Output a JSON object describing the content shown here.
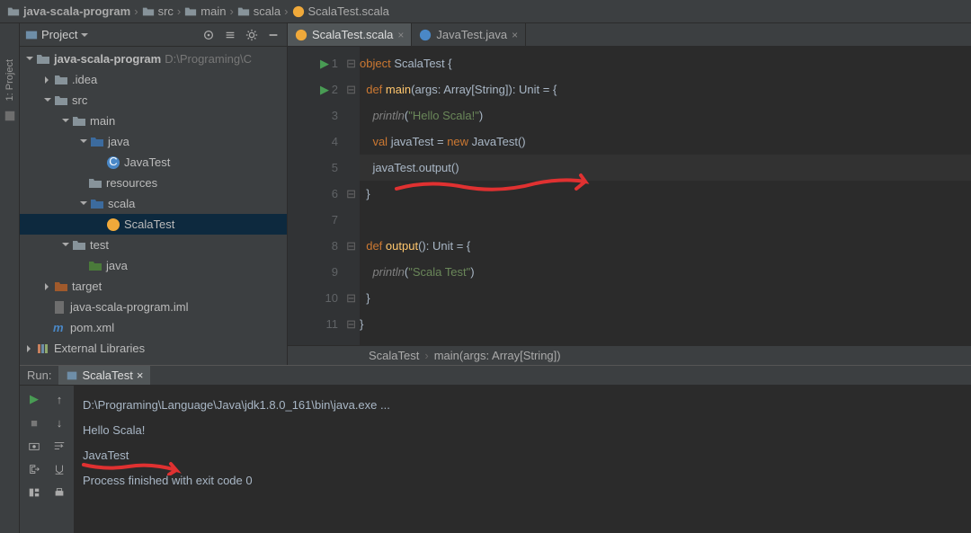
{
  "breadcrumb": {
    "project": "java-scala-program",
    "items": [
      "src",
      "main",
      "scala"
    ],
    "file": "ScalaTest.scala"
  },
  "sidebar": {
    "project_label": "1: Project"
  },
  "tool": {
    "title": "Project"
  },
  "tree": {
    "root": {
      "name": "java-scala-program",
      "hint": "D:\\Programing\\C"
    },
    "idea": ".idea",
    "src": "src",
    "main": "main",
    "java": "java",
    "javaTest": "JavaTest",
    "resources": "resources",
    "scala": "scala",
    "scalaTest": "ScalaTest",
    "test": "test",
    "testjava": "java",
    "target": "target",
    "iml": "java-scala-program.iml",
    "pom": "pom.xml",
    "ext": "External Libraries"
  },
  "tabs": [
    {
      "label": "ScalaTest.scala",
      "icon": "scala",
      "active": true
    },
    {
      "label": "JavaTest.java",
      "icon": "java",
      "active": false
    }
  ],
  "code": {
    "l1": {
      "a": "object ",
      "b": "ScalaTest ",
      "c": "{"
    },
    "l2": {
      "a": "  def ",
      "b": "main",
      "c": "(args: Array[",
      "d": "String",
      "e": "]): Unit = {"
    },
    "l3": {
      "a": "    ",
      "b": "println",
      "c": "(",
      "d": "\"Hello Scala!\"",
      "e": ")"
    },
    "l4": {
      "a": "    val ",
      "b": "javaTest = ",
      "c": "new ",
      "d": "JavaTest()"
    },
    "l5": {
      "a": "    javaTest.output()"
    },
    "l6": {
      "a": "  }"
    },
    "l7": {
      "a": ""
    },
    "l8": {
      "a": "  def ",
      "b": "output",
      "c": "(): Unit = {"
    },
    "l9": {
      "a": "    ",
      "b": "println",
      "c": "(",
      "d": "\"Scala Test\"",
      "e": ")"
    },
    "l10": {
      "a": "  }"
    },
    "l11": {
      "a": "}"
    }
  },
  "lines": [
    "1",
    "2",
    "3",
    "4",
    "5",
    "6",
    "7",
    "8",
    "9",
    "10",
    "11"
  ],
  "crumb": {
    "a": "ScalaTest",
    "b": "main(args: Array[String])"
  },
  "run": {
    "label": "Run:",
    "tab": "ScalaTest",
    "out": [
      "D:\\Programing\\Language\\Java\\jdk1.8.0_161\\bin\\java.exe ...",
      "Hello Scala!",
      "JavaTest",
      "",
      "Process finished with exit code 0"
    ]
  }
}
